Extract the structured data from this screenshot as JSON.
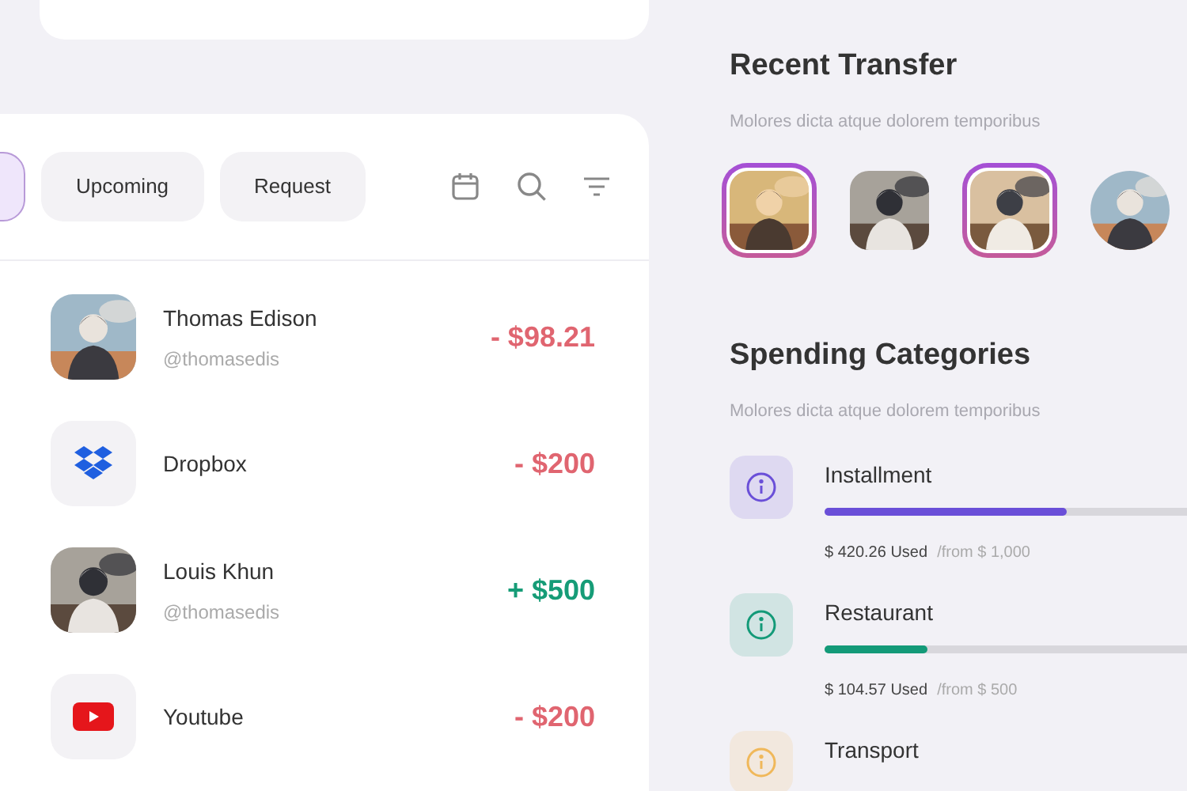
{
  "filter_tabs": [
    {
      "selected": true
    },
    {
      "label": "Upcoming",
      "selected": false
    },
    {
      "label": "Request",
      "selected": false
    }
  ],
  "transactions": [
    {
      "kind": "person",
      "name": "Thomas Edison",
      "handle": "@thomasedis",
      "amount": {
        "kind": "debit",
        "text": "- $98.21"
      }
    },
    {
      "kind": "dropbox",
      "name": "Dropbox",
      "amount": {
        "kind": "debit",
        "text": "- $200"
      }
    },
    {
      "kind": "person",
      "name": "Louis Khun",
      "handle": "@thomasedis",
      "amount": {
        "kind": "credit",
        "text": "+ $500"
      }
    },
    {
      "kind": "youtube",
      "name": "Youtube",
      "amount": {
        "kind": "debit",
        "text": "- $200"
      }
    }
  ],
  "recent_transfer": {
    "title": "Recent Transfer",
    "subtitle": "Molores dicta atque dolorem temporibus",
    "people": [
      {
        "selected": true
      },
      {
        "selected": false
      },
      {
        "selected": true
      },
      {
        "selected": false
      }
    ]
  },
  "spending_categories": {
    "title": "Spending Categories",
    "subtitle": "Molores dicta atque dolorem temporibus",
    "items": [
      {
        "name": "Installment",
        "color": "#6a4fd8",
        "level": 0.59,
        "used": "$ 420.26 Used",
        "limit": "/from $ 1,000"
      },
      {
        "name": "Restaurant",
        "color": "#139a78",
        "level": 0.25,
        "used": "$ 104.57 Used",
        "limit": "/from $ 500"
      },
      {
        "name": "Transport",
        "color": "#f0b85a"
      }
    ]
  }
}
